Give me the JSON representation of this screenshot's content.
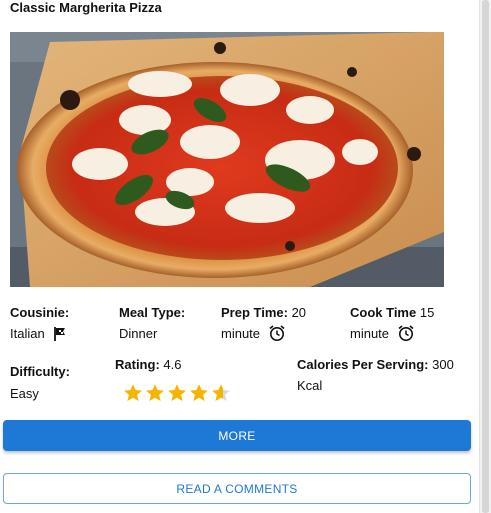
{
  "recipe": {
    "title": "Classic Margherita Pizza",
    "image_icon": "pizza-photo"
  },
  "details": {
    "cuisine_label": "Cousinie:",
    "cuisine_value": "Italian",
    "cuisine_icon": "flag-icon",
    "meal_type_label": "Meal Type:",
    "meal_type_value": "Dinner",
    "prep_time_label": "Prep Time:",
    "prep_time_value": "20",
    "prep_time_unit": "minute",
    "cook_time_label": "Cook Time",
    "cook_time_value": "15",
    "cook_time_unit": "minute",
    "time_icon": "alarm-clock-icon",
    "difficulty_label": "Difficulty:",
    "difficulty_value": "Easy",
    "rating_label": "Rating:",
    "rating_value": "4.6",
    "rating_stars": 4.6,
    "rating_max": 5,
    "calories_label": "Calories Per Serving:",
    "calories_value": "300",
    "calories_unit": "Kcal"
  },
  "actions": {
    "more_label": "MORE",
    "comments_label": "READ A COMMENTS"
  },
  "colors": {
    "accent": "#1e78d6",
    "star": "#f5b400",
    "star_empty": "#d9d9d9"
  }
}
